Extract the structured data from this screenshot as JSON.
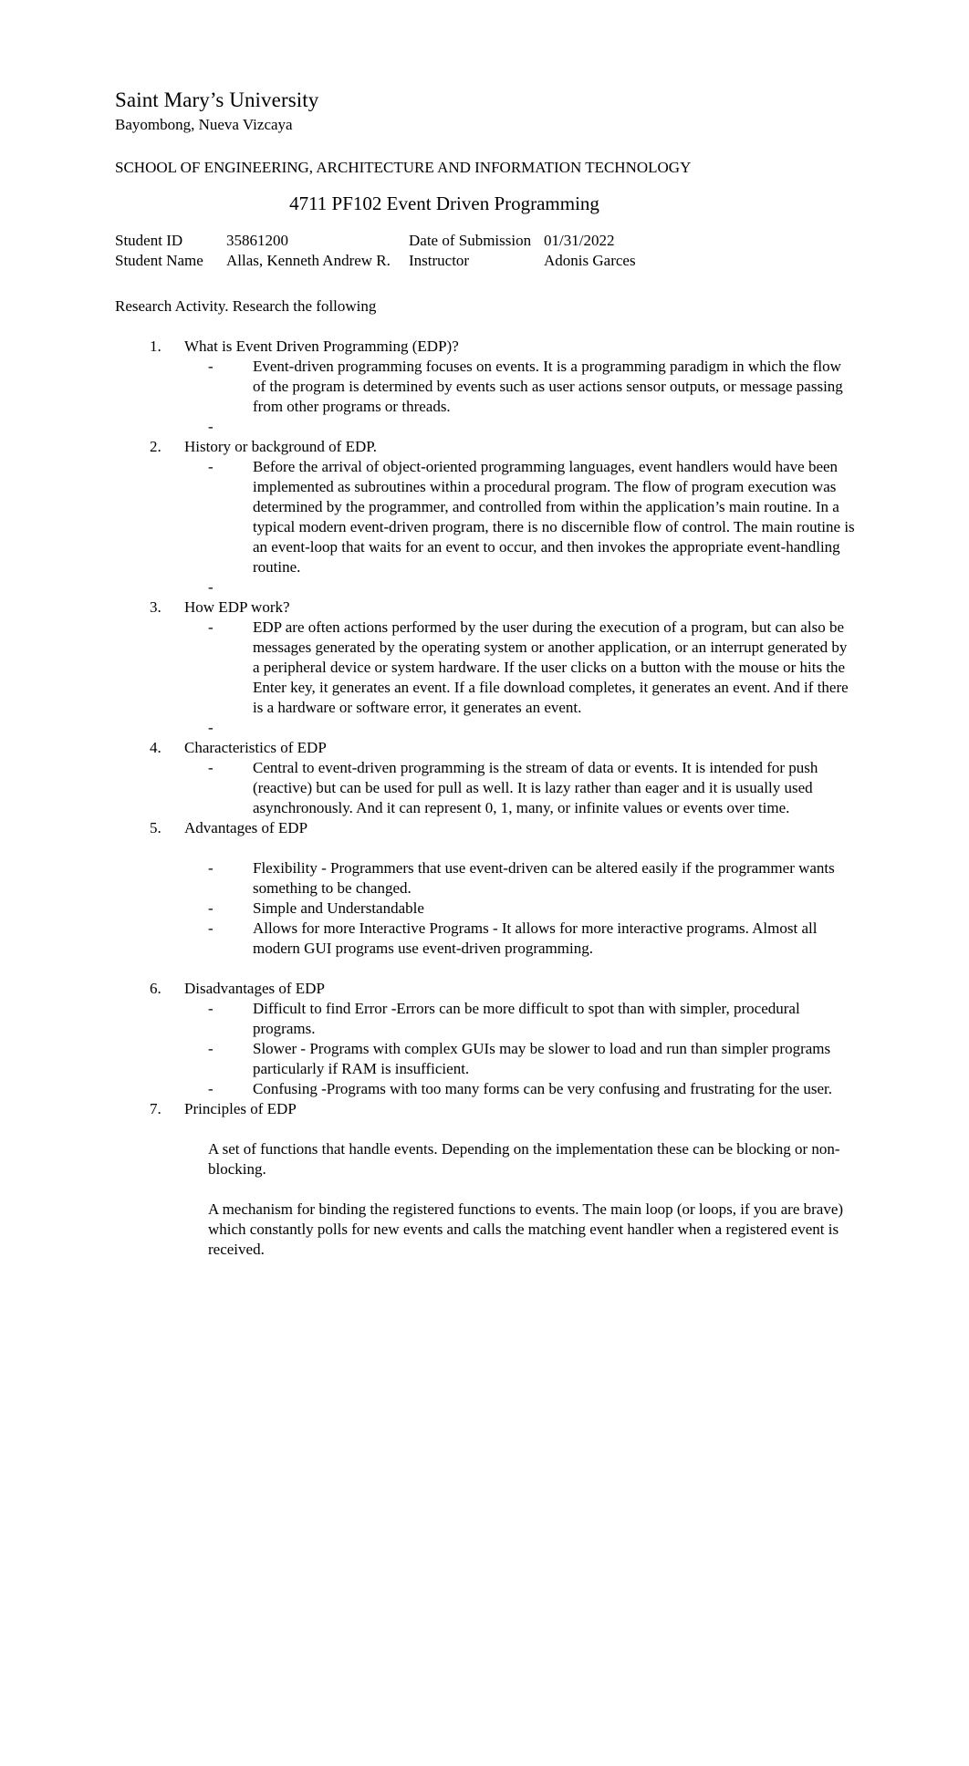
{
  "header": {
    "university": "Saint Mary’s University",
    "address": "Bayombong, Nueva Vizcaya",
    "school": "SCHOOL OF ENGINEERING, ARCHITECTURE AND INFORMATION TECHNOLOGY",
    "course_title": "4711 PF102 Event Driven Programming"
  },
  "info": {
    "student_id_label": "Student ID",
    "student_id_value": "35861200",
    "date_label": "Date of Submission",
    "date_value": "01/31/2022",
    "student_name_label": "Student Name",
    "student_name_value": "Allas, Kenneth Andrew R.",
    "instructor_label": "Instructor",
    "instructor_value": "Adonis Garces"
  },
  "activity": {
    "heading": "Research Activity. Research the following"
  },
  "items": [
    {
      "heading": "What is Event Driven Programming (EDP)?",
      "bullets": [
        "Event-driven programming focuses on events.  It is a programming paradigm in which the flow of the program is determined by events  such as user actions sensor outputs, or message passing from other programs or threads.",
        ""
      ]
    },
    {
      "heading": "History or background of EDP.",
      "bullets": [
        "Before the arrival of object-oriented programming languages, event handlers would have been implemented as subroutines within a procedural program. The flow of program execution was determined by the programmer, and controlled from within the application’s main routine.  In a typical modern event-driven program, there is no discernible flow of control. The main routine is an event-loop that waits for an event to occur, and then invokes the appropriate event-handling routine.",
        ""
      ]
    },
    {
      "heading": "How EDP work?",
      "bullets": [
        "EDP are often actions performed by the user during the execution of a program, but can also be messages generated by the operating system or another application, or an interrupt generated by a peripheral device or system hardware. If the user clicks on a button with the mouse or hits the  Enter key, it generates an event. If a file download completes, it generates an event. And if there is a hardware or software error, it generates an event.",
        ""
      ]
    },
    {
      "heading": "Characteristics of EDP",
      "bullets": [
        "Central to event-driven programming is the stream of data or events. It is intended for push (reactive) but can be used for pull as well. It is lazy rather than eager and it is usually used asynchronously. And it can represent 0, 1, many, or infinite values or events over time."
      ]
    },
    {
      "heading": "Advantages of EDP",
      "bullets": [
        "Flexibility - Programmers that use event-driven can be altered easily if the programmer wants something to be changed.",
        "Simple and Understandable",
        "Allows for more Interactive Programs - It allows for more interactive programs. Almost all modern GUI programs use event-driven programming."
      ]
    },
    {
      "heading": "Disadvantages of EDP",
      "bullets": [
        "Difficult to find Error -Errors can be more difficult to spot than with simpler, procedural programs.",
        "Slower - Programs with complex GUIs may be slower to load and run than simpler programs particularly if RAM is insufficient.",
        "Confusing -Programs with too many forms can be very confusing and frustrating for the user."
      ]
    },
    {
      "heading": "Principles of EDP",
      "paragraphs": [
        "A set of functions that handle events. Depending on the implementation these can be blocking or non-blocking.",
        "A mechanism for binding the registered functions to events. The main loop (or loops, if you are brave) which constantly polls for new events and calls the matching event handler when a registered event is received."
      ]
    }
  ]
}
